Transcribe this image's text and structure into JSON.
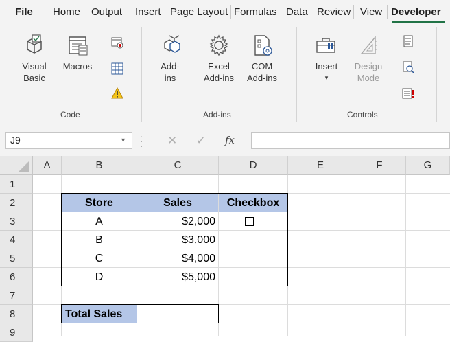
{
  "ribbon_tabs": [
    "File",
    "Home",
    "Output",
    "Insert",
    "Page Layout",
    "Formulas",
    "Data",
    "Review",
    "View",
    "Developer"
  ],
  "active_tab": "Developer",
  "ribbon": {
    "code": {
      "visual_basic_line1": "Visual",
      "visual_basic_line2": "Basic",
      "macros": "Macros",
      "group_label": "Code"
    },
    "addins": {
      "addins_line1": "Add-",
      "addins_line2": "ins",
      "excel_addins_line1": "Excel",
      "excel_addins_line2": "Add-ins",
      "com_addins_line1": "COM",
      "com_addins_line2": "Add-ins",
      "group_label": "Add-ins"
    },
    "controls": {
      "insert": "Insert",
      "insert_caret": "▾",
      "design_mode_line1": "Design",
      "design_mode_line2": "Mode",
      "group_label": "Controls"
    }
  },
  "formula_bar": {
    "name_box": "J9",
    "fx_symbol": "fx",
    "cancel_symbol": "✕",
    "enter_symbol": "✓",
    "formula": ""
  },
  "columns": [
    "A",
    "B",
    "C",
    "D",
    "E",
    "F",
    "G"
  ],
  "rows": [
    "1",
    "2",
    "3",
    "4",
    "5",
    "6",
    "7",
    "8",
    "9"
  ],
  "table": {
    "headers": [
      "Store",
      "Sales",
      "Checkbox"
    ],
    "rows": [
      {
        "store": "A",
        "sales": "$2,000"
      },
      {
        "store": "B",
        "sales": "$3,000"
      },
      {
        "store": "C",
        "sales": "$4,000"
      },
      {
        "store": "D",
        "sales": "$5,000"
      }
    ],
    "total_label": "Total Sales",
    "total_value": ""
  },
  "colors": {
    "accent_green": "#217346",
    "header_fill": "#b4c6e7"
  }
}
